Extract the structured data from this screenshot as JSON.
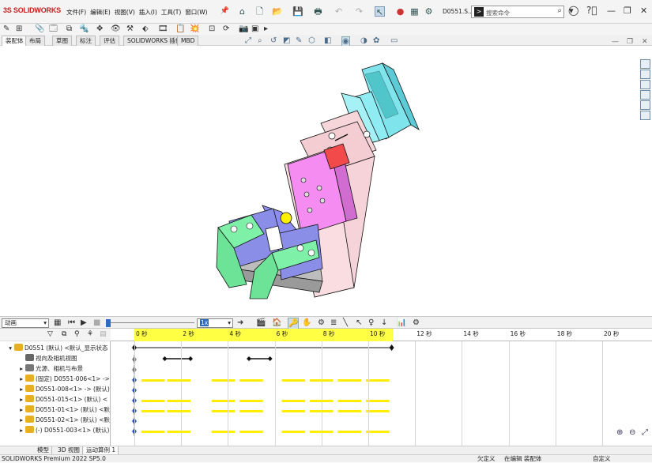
{
  "app": {
    "brand_ds": "3S",
    "brand": "SOLIDWORKS",
    "document": "D0551.S...",
    "search_placeholder": "搜索命令"
  },
  "menu": [
    "文件(F)",
    "编辑(E)",
    "视图(V)",
    "插入(I)",
    "工具(T)",
    "窗口(W)"
  ],
  "command_tabs": [
    {
      "label": "装配体",
      "active": true
    },
    {
      "label": "布局",
      "active": false
    },
    {
      "label": "草图",
      "active": false
    },
    {
      "label": "标注",
      "active": false
    },
    {
      "label": "评估",
      "active": false
    },
    {
      "label": "SOLIDWORKS 插件",
      "active": false
    },
    {
      "label": "MBD",
      "active": false
    }
  ],
  "motion": {
    "study_type": "动画",
    "playback_speed": "1x"
  },
  "timeline": {
    "ticks": [
      "0 秒",
      "2 秒",
      "4 秒",
      "6 秒",
      "8 秒",
      "10 秒",
      "12 秒",
      "14 秒",
      "16 秒",
      "18 秒",
      "20 秒"
    ],
    "tick_values_s": [
      0,
      2,
      4,
      6,
      8,
      10,
      12,
      14,
      16,
      18,
      20
    ],
    "selected_end_s": 11,
    "segments_s": [
      [
        0.3,
        1.3
      ],
      [
        1.4,
        2.4
      ],
      [
        3.3,
        4.3
      ],
      [
        4.5,
        5.5
      ],
      [
        6.3,
        7.3
      ],
      [
        7.5,
        8.5
      ],
      [
        8.7,
        9.7
      ],
      [
        9.9,
        10.9
      ]
    ]
  },
  "tree": [
    {
      "label": "D0551 (默认) <默认_显示状态",
      "icon": "assembly-icon",
      "expand": "▾"
    },
    {
      "label": "视向及相机视图",
      "icon": "camera-icon",
      "expand": ""
    },
    {
      "label": "光源、相机与布景",
      "icon": "lights-icon",
      "expand": "▸"
    },
    {
      "label": "(固定) D0551-006<1> ->",
      "icon": "part-icon",
      "expand": "▸"
    },
    {
      "label": "D0551-008<1> -> (默认)",
      "icon": "part-icon",
      "expand": "▸"
    },
    {
      "label": "D0551-015<1> (默认) <",
      "icon": "part-icon",
      "expand": "▸"
    },
    {
      "label": "D0551-01<1> (默认) <默",
      "icon": "part-icon",
      "expand": "▸"
    },
    {
      "label": "D0551-02<1> (默认) <默",
      "icon": "part-icon",
      "expand": "▸"
    },
    {
      "label": "(-) D0551-003<1> (默认)",
      "icon": "part-icon",
      "expand": "▸"
    }
  ],
  "bottom_tabs": [
    {
      "label": "模型",
      "active": false
    },
    {
      "label": "3D 视图",
      "active": false
    },
    {
      "label": "运动算例 1",
      "active": true
    }
  ],
  "status": {
    "version": "SOLIDWORKS Premium 2022 SP5.0",
    "constraint": "欠定义",
    "mode": "在编辑 装配体",
    "units": "自定义"
  },
  "colors": {
    "accent": "#c8201e",
    "timeline_yellow": "#ffff44",
    "segment_yellow": "#ffee00"
  }
}
